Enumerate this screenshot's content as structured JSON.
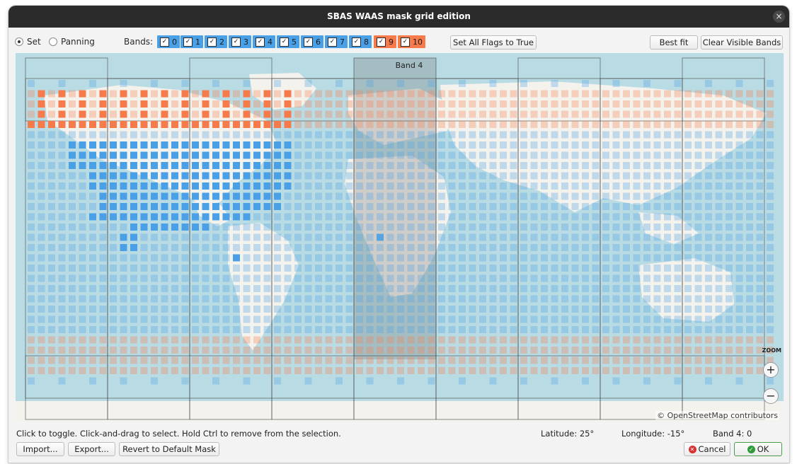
{
  "window": {
    "title": "SBAS WAAS mask grid edition"
  },
  "toolbar": {
    "mode_set": "Set",
    "mode_panning": "Panning",
    "mode_selected": "Set",
    "bands_label": "Bands:",
    "bands": [
      {
        "label": "0",
        "checked": true,
        "color": "#4aa0e6"
      },
      {
        "label": "1",
        "checked": true,
        "color": "#4aa0e6"
      },
      {
        "label": "2",
        "checked": true,
        "color": "#4aa0e6"
      },
      {
        "label": "3",
        "checked": true,
        "color": "#4aa0e6"
      },
      {
        "label": "4",
        "checked": true,
        "color": "#4aa0e6"
      },
      {
        "label": "5",
        "checked": true,
        "color": "#4aa0e6"
      },
      {
        "label": "6",
        "checked": true,
        "color": "#4aa0e6"
      },
      {
        "label": "7",
        "checked": true,
        "color": "#4aa0e6"
      },
      {
        "label": "8",
        "checked": true,
        "color": "#4aa0e6"
      },
      {
        "label": "9",
        "checked": true,
        "color": "#f77a4a"
      },
      {
        "label": "10",
        "checked": true,
        "color": "#f77a4a"
      }
    ],
    "set_all_flags": "Set All Flags to True",
    "best_fit": "Best fit",
    "clear_visible": "Clear Visible Bands"
  },
  "map": {
    "highlight_band_label": "Band 4",
    "zoom_label": "ZOOM",
    "zoom_in": "+",
    "zoom_out": "−",
    "attribution": "© OpenStreetMap contributors",
    "colors": {
      "ocean": "#aad3df",
      "land": "#f2efe9",
      "band_blue": "#4aa0e6",
      "band_orange": "#f77a4a"
    }
  },
  "status": {
    "hint": "Click to toggle. Click-and-drag to select. Hold Ctrl to remove from the selection.",
    "latitude": "Latitude:  25°",
    "longitude": "Longitude:  -15°",
    "band_count": "Band 4:  0"
  },
  "footer": {
    "import": "Import...",
    "export": "Export...",
    "revert": "Revert to Default Mask",
    "cancel": "Cancel",
    "ok": "OK"
  }
}
